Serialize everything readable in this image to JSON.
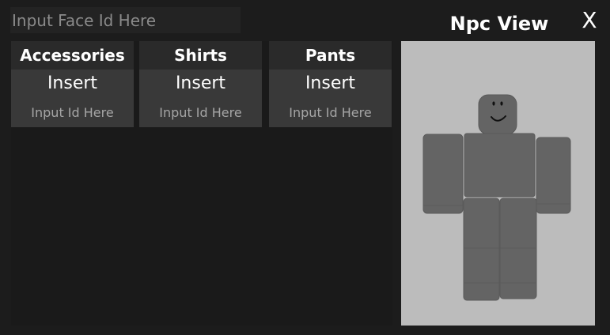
{
  "face_input": {
    "placeholder": "Input Face Id Here",
    "value": ""
  },
  "columns": [
    {
      "header": "Accessories",
      "insert_label": "Insert",
      "input_placeholder": "Input Id Here"
    },
    {
      "header": "Shirts",
      "insert_label": "Insert",
      "input_placeholder": "Input Id Here"
    },
    {
      "header": "Pants",
      "insert_label": "Insert",
      "input_placeholder": "Input Id Here"
    }
  ],
  "npc_view": {
    "title": "Npc View",
    "close_label": "X"
  },
  "colors": {
    "background": "#1c1c1c",
    "header": "#2a2a2a",
    "button": "#393939",
    "viewport": "#bcbcbc",
    "avatar": "#646464"
  },
  "icons": {
    "avatar": "npc-avatar-icon",
    "face": "smiley-face-icon"
  }
}
